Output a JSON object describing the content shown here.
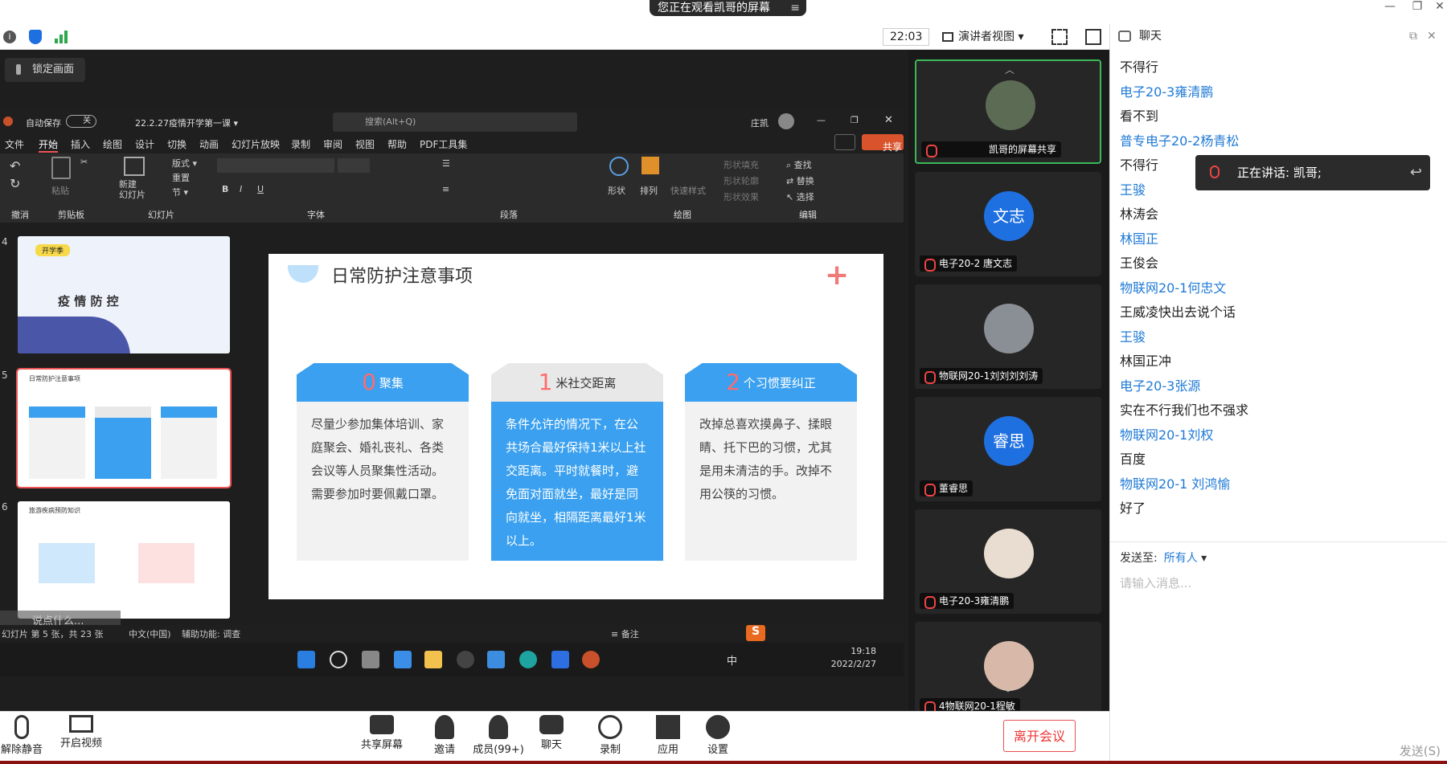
{
  "topbar": {
    "viewing_text": "您正在观看凯哥的屏幕"
  },
  "toolbar": {
    "time": "22:03",
    "view_mode": "演讲者视图"
  },
  "share": {
    "lock_label": "锁定画面"
  },
  "ppt": {
    "autosave": "自动保存",
    "autosave_state": "关",
    "doc_name": "22.2.27疫情开学第一课",
    "search_placeholder": "搜索(Alt+Q)",
    "user": "庄凯",
    "share_btn": "共享",
    "menu": [
      "文件",
      "开始",
      "插入",
      "绘图",
      "设计",
      "切换",
      "动画",
      "幻灯片放映",
      "录制",
      "审阅",
      "视图",
      "帮助",
      "PDF工具集"
    ],
    "groups": [
      "撤消",
      "剪贴板",
      "幻灯片",
      "字体",
      "段落",
      "绘图",
      "编辑"
    ],
    "ribbon": {
      "paste": "粘贴",
      "new_slide": "新建\n幻灯片",
      "layout": "版式",
      "reset": "重置",
      "section": "节",
      "shape": "形状",
      "arrange": "排列",
      "quick_style": "快速样式",
      "fill": "形状填充",
      "outline": "形状轮廓",
      "effect": "形状效果",
      "find": "查找",
      "replace": "替换",
      "select": "选择"
    },
    "thumb_nums": [
      "4",
      "5",
      "6"
    ],
    "thumb4_title": "疫 情 防 控",
    "thumb4_tag": "开学季",
    "thumb5_title": "日常防护注意事项",
    "thumb6_title": "旅游疾病预防知识",
    "slide": {
      "title": "日常防护注意事项",
      "cards": [
        {
          "num": "0",
          "head": "聚集",
          "body": "尽量少参加集体培训、家庭聚会、婚礼丧礼、各类会议等人员聚集性活动。需要参加时要佩戴口罩。"
        },
        {
          "num": "1",
          "head": "米社交距离",
          "body": "条件允许的情况下，在公共场合最好保持1米以上社交距离。平时就餐时，避免面对面就坐，最好是同向就坐，相隔距离最好1米以上。"
        },
        {
          "num": "2",
          "head": "个习惯要纠正",
          "body": "改掉总喜欢摸鼻子、揉眼睛、托下巴的习惯，尤其是用未清洁的手。改掉不用公筷的习惯。"
        }
      ]
    },
    "status": {
      "slide_info": "幻灯片 第 5 张，共 23 张",
      "lang": "中文(中国)",
      "access": "辅助功能: 调查",
      "notes": "备注",
      "overlay": "说点什么..."
    },
    "taskbar": {
      "ime": "中",
      "time": "19:18",
      "date": "2022/2/27"
    }
  },
  "videos": [
    {
      "name": "凯哥的屏幕共享",
      "type": "photo"
    },
    {
      "name": "电子20-2 唐文志",
      "type": "avatar",
      "initials": "文志"
    },
    {
      "name": "物联网20-1刘刘刘刘涛",
      "type": "photo"
    },
    {
      "name": "董睿思",
      "type": "avatar",
      "initials": "睿思"
    },
    {
      "name": "电子20-3雍清鹏",
      "type": "photo"
    },
    {
      "name": "4物联网20-1程敏",
      "type": "photo"
    }
  ],
  "chat": {
    "title": "聊天",
    "messages": [
      {
        "text": "不得行",
        "color": "black"
      },
      {
        "text": "电子20-3雍清鹏",
        "color": "blue"
      },
      {
        "text": "看不到",
        "color": "black"
      },
      {
        "text": "普专电子20-2杨青松",
        "color": "blue"
      },
      {
        "text": "不得行",
        "color": "black"
      },
      {
        "text": "王骏",
        "color": "blue"
      },
      {
        "text": "林涛会",
        "color": "black"
      },
      {
        "text": "林国正",
        "color": "blue"
      },
      {
        "text": "王俊会",
        "color": "black"
      },
      {
        "text": "物联网20-1何忠文",
        "color": "blue"
      },
      {
        "text": "王威凌快出去说个话",
        "color": "black"
      },
      {
        "text": "王骏",
        "color": "blue"
      },
      {
        "text": "林国正冲",
        "color": "black"
      },
      {
        "text": "电子20-3张源",
        "color": "blue"
      },
      {
        "text": "实在不行我们也不强求",
        "color": "black"
      },
      {
        "text": "物联网20-1刘权",
        "color": "blue"
      },
      {
        "text": "百度",
        "color": "black"
      },
      {
        "text": "物联网20-1 刘鸿愉",
        "color": "blue"
      },
      {
        "text": "好了",
        "color": "black"
      }
    ],
    "speaking": "正在讲话: 凯哥;",
    "send_to_label": "发送至:",
    "send_to_value": "所有人",
    "input_placeholder": "请输入消息...",
    "send_button": "发送(S)"
  },
  "bottom": {
    "mute": "解除静音",
    "video": "开启视频",
    "share": "共享屏幕",
    "invite": "邀请",
    "members": "成员(99+)",
    "chat": "聊天",
    "record": "录制",
    "apps": "应用",
    "settings": "设置",
    "leave": "离开会议"
  },
  "colors": {
    "accent": "#3aa0ef",
    "link": "#1f7ad6",
    "leave": "#e33"
  }
}
